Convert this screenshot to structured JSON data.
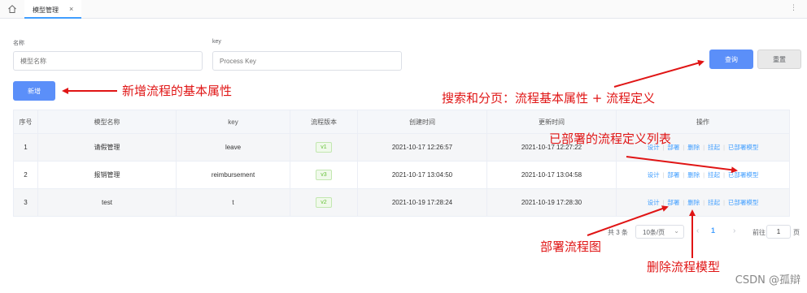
{
  "tabs": {
    "home_icon": "home-icon",
    "active_tab": "模型管理",
    "close": "×",
    "more": "⋮"
  },
  "search": {
    "name_label": "名称",
    "name_placeholder": "模型名称",
    "key_label": "key",
    "key_placeholder": "Process Key",
    "query_button": "查询",
    "reset_button": "重置"
  },
  "toolbar": {
    "new_button": "新增"
  },
  "table": {
    "headers": [
      "序号",
      "模型名称",
      "key",
      "流程版本",
      "创建时间",
      "更新时间",
      "操作"
    ],
    "rows": [
      {
        "index": "1",
        "name": "请假管理",
        "key": "leave",
        "version": "v1",
        "created": "2021-10-17 12:26:57",
        "updated": "2021-10-17 12:27:22"
      },
      {
        "index": "2",
        "name": "报销管理",
        "key": "reimbursement",
        "version": "v3",
        "created": "2021-10-17 13:04:50",
        "updated": "2021-10-17 13:04:58"
      },
      {
        "index": "3",
        "name": "test",
        "key": "t",
        "version": "v2",
        "created": "2021-10-19 17:28:24",
        "updated": "2021-10-19 17:28:30"
      }
    ],
    "actions": [
      "设计",
      "部署",
      "删除",
      "挂起",
      "已部署模型"
    ]
  },
  "pagination": {
    "total": "共 3 条",
    "page_size": "10条/页",
    "prev": "‹",
    "current": "1",
    "next": "›",
    "goto_label": "前往",
    "goto_value": "1",
    "page_suffix": "页"
  },
  "annotations": {
    "new_attrs": "新增流程的基本属性",
    "search_paging": "搜索和分页：流程基本属性 + 流程定义",
    "deployed_list": "已部署的流程定义列表",
    "deploy_diagram": "部署流程图",
    "delete_model": "删除流程模型"
  },
  "watermark": "CSDN @孤辯",
  "colors": {
    "primary": "#5b8ff9",
    "link": "#409eff",
    "annotation": "#e01515",
    "tag_green": "#67c23a"
  }
}
